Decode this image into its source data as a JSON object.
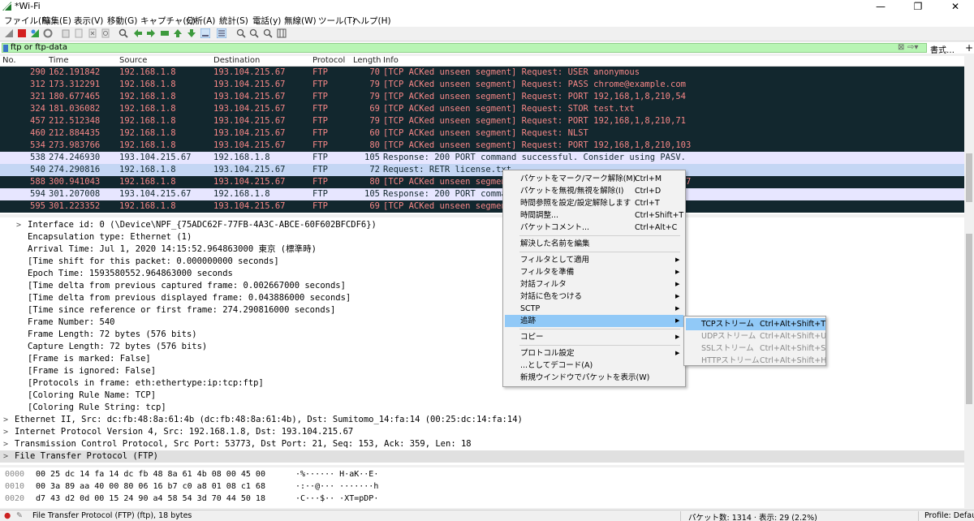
{
  "window": {
    "title": "*Wi-Fi",
    "minimize": "—",
    "restore": "❐",
    "close": "✕"
  },
  "menu": [
    "ファイル(F)",
    "編集(E)",
    "表示(V)",
    "移動(G)",
    "キャプチャ(C)",
    "分析(A)",
    "統計(S)",
    "電話(y)",
    "無線(W)",
    "ツール(T)",
    "ヘルプ(H)"
  ],
  "filter": {
    "value": "ftp or ftp-data",
    "expression_label": "書式…",
    "add_label": "+"
  },
  "columns": [
    "No.",
    "Time",
    "Source",
    "Destination",
    "Protocol",
    "Length",
    "Info"
  ],
  "packets": [
    {
      "no": "290",
      "time": "162.191842",
      "src": "192.168.1.8",
      "dst": "193.104.215.67",
      "proto": "FTP",
      "len": "70",
      "info": "[TCP ACKed unseen segment] Request: USER anonymous",
      "style": "dark"
    },
    {
      "no": "312",
      "time": "173.312291",
      "src": "192.168.1.8",
      "dst": "193.104.215.67",
      "proto": "FTP",
      "len": "79",
      "info": "[TCP ACKed unseen segment] Request: PASS chrome@example.com",
      "style": "dark"
    },
    {
      "no": "321",
      "time": "180.677465",
      "src": "192.168.1.8",
      "dst": "193.104.215.67",
      "proto": "FTP",
      "len": "79",
      "info": "[TCP ACKed unseen segment] Request: PORT 192,168,1,8,210,54",
      "style": "dark"
    },
    {
      "no": "324",
      "time": "181.036082",
      "src": "192.168.1.8",
      "dst": "193.104.215.67",
      "proto": "FTP",
      "len": "69",
      "info": "[TCP ACKed unseen segment] Request: STOR test.txt",
      "style": "dark"
    },
    {
      "no": "457",
      "time": "212.512348",
      "src": "192.168.1.8",
      "dst": "193.104.215.67",
      "proto": "FTP",
      "len": "79",
      "info": "[TCP ACKed unseen segment] Request: PORT 192,168,1,8,210,71",
      "style": "dark"
    },
    {
      "no": "460",
      "time": "212.884435",
      "src": "192.168.1.8",
      "dst": "193.104.215.67",
      "proto": "FTP",
      "len": "60",
      "info": "[TCP ACKed unseen segment] Request: NLST",
      "style": "dark"
    },
    {
      "no": "534",
      "time": "273.983766",
      "src": "192.168.1.8",
      "dst": "193.104.215.67",
      "proto": "FTP",
      "len": "80",
      "info": "[TCP ACKed unseen segment] Request: PORT 192,168,1,8,210,103",
      "style": "dark"
    },
    {
      "no": "538",
      "time": "274.246930",
      "src": "193.104.215.67",
      "dst": "192.168.1.8",
      "proto": "FTP",
      "len": "105",
      "info": "Response: 200 PORT command successful. Consider using PASV.",
      "style": "light"
    },
    {
      "no": "540",
      "time": "274.290816",
      "src": "192.168.1.8",
      "dst": "193.104.215.67",
      "proto": "FTP",
      "len": "72",
      "info": "Request: RETR license.txt",
      "style": "sel"
    },
    {
      "no": "588",
      "time": "300.941043",
      "src": "192.168.1.8",
      "dst": "193.104.215.67",
      "proto": "FTP",
      "len": "80",
      "info": "[TCP ACKed unseen segment] Request: PORT 192,168,1,8,210,107",
      "style": "dark"
    },
    {
      "no": "594",
      "time": "301.207008",
      "src": "193.104.215.67",
      "dst": "192.168.1.8",
      "proto": "FTP",
      "len": "105",
      "info": "Response: 200 PORT command successful. Consider using PASV.",
      "style": "light"
    },
    {
      "no": "595",
      "time": "301.223352",
      "src": "192.168.1.8",
      "dst": "193.104.215.67",
      "proto": "FTP",
      "len": "69",
      "info": "[TCP ACKed unseen segment] Request: RETR test.txt",
      "style": "dark"
    }
  ],
  "details": [
    {
      "indent": 1,
      "arrow": ">",
      "text": "Interface id: 0 (\\Device\\NPF_{75ADC62F-77FB-4A3C-ABCE-60F602BFCDF6})"
    },
    {
      "indent": 1,
      "arrow": "",
      "text": "Encapsulation type: Ethernet (1)"
    },
    {
      "indent": 1,
      "arrow": "",
      "text": "Arrival Time: Jul  1, 2020 14:15:52.964863000 東京 (標準時)"
    },
    {
      "indent": 1,
      "arrow": "",
      "text": "[Time shift for this packet: 0.000000000 seconds]"
    },
    {
      "indent": 1,
      "arrow": "",
      "text": "Epoch Time: 1593580552.964863000 seconds"
    },
    {
      "indent": 1,
      "arrow": "",
      "text": "[Time delta from previous captured frame: 0.002667000 seconds]"
    },
    {
      "indent": 1,
      "arrow": "",
      "text": "[Time delta from previous displayed frame: 0.043886000 seconds]"
    },
    {
      "indent": 1,
      "arrow": "",
      "text": "[Time since reference or first frame: 274.290816000 seconds]"
    },
    {
      "indent": 1,
      "arrow": "",
      "text": "Frame Number: 540"
    },
    {
      "indent": 1,
      "arrow": "",
      "text": "Frame Length: 72 bytes (576 bits)"
    },
    {
      "indent": 1,
      "arrow": "",
      "text": "Capture Length: 72 bytes (576 bits)"
    },
    {
      "indent": 1,
      "arrow": "",
      "text": "[Frame is marked: False]"
    },
    {
      "indent": 1,
      "arrow": "",
      "text": "[Frame is ignored: False]"
    },
    {
      "indent": 1,
      "arrow": "",
      "text": "[Protocols in frame: eth:ethertype:ip:tcp:ftp]"
    },
    {
      "indent": 1,
      "arrow": "",
      "text": "[Coloring Rule Name: TCP]"
    },
    {
      "indent": 1,
      "arrow": "",
      "text": "[Coloring Rule String: tcp]"
    },
    {
      "indent": 0,
      "arrow": ">",
      "text": "Ethernet II, Src: dc:fb:48:8a:61:4b (dc:fb:48:8a:61:4b), Dst: Sumitomo_14:fa:14 (00:25:dc:14:fa:14)"
    },
    {
      "indent": 0,
      "arrow": ">",
      "text": "Internet Protocol Version 4, Src: 192.168.1.8, Dst: 193.104.215.67"
    },
    {
      "indent": 0,
      "arrow": ">",
      "text": "Transmission Control Protocol, Src Port: 53773, Dst Port: 21, Seq: 153, Ack: 359, Len: 18"
    },
    {
      "indent": 0,
      "arrow": ">",
      "text": "File Transfer Protocol (FTP)",
      "highlight": true
    }
  ],
  "bytes": [
    {
      "off": "0000",
      "hex": "00 25 dc 14 fa 14 dc fb  48 8a 61 4b 08 00 45 00",
      "ascii": "·%······ H·aK··E·"
    },
    {
      "off": "0010",
      "hex": "00 3a 89 aa 40 00 80 06  16 b7 c0 a8 01 08 c1 68",
      "ascii": "·:··@··· ·······h"
    },
    {
      "off": "0020",
      "hex": "d7 43 d2 0d 00 15 24 90  a4 58 54 3d 70 44 50 18",
      "ascii": "·C···$·· ·XT=pDP·"
    }
  ],
  "status": {
    "left": "File Transfer Protocol (FTP) (ftp), 18 bytes",
    "packets": "パケット数: 1314 · 表示: 29 (2.2%)",
    "profile": "Profile: Default"
  },
  "context_menu": [
    {
      "label": "パケットをマーク/マーク解除(M)",
      "shortcut": "Ctrl+M"
    },
    {
      "label": "パケットを無視/無視を解除(I)",
      "shortcut": "Ctrl+D"
    },
    {
      "label": "時間参照を設定/設定解除します",
      "shortcut": "Ctrl+T"
    },
    {
      "label": "時間調整...",
      "shortcut": "Ctrl+Shift+T"
    },
    {
      "label": "パケットコメント...",
      "shortcut": "Ctrl+Alt+C"
    },
    {
      "label": "解決した名前を編集",
      "shortcut": ""
    },
    {
      "label": "フィルタとして適用",
      "shortcut": "",
      "sub": true
    },
    {
      "label": "フィルタを準備",
      "shortcut": "",
      "sub": true
    },
    {
      "label": "対話フィルタ",
      "shortcut": "",
      "sub": true
    },
    {
      "label": "対話に色をつける",
      "shortcut": "",
      "sub": true
    },
    {
      "label": "SCTP",
      "shortcut": "",
      "sub": true
    },
    {
      "label": "追跡",
      "shortcut": "",
      "sub": true,
      "active": true
    },
    {
      "label": "コピー",
      "shortcut": "",
      "sub": true
    },
    {
      "label": "プロトコル設定",
      "shortcut": "",
      "sub": true
    },
    {
      "label": "...としてデコード(A)",
      "shortcut": ""
    },
    {
      "label": "新規ウインドウでパケットを表示(W)",
      "shortcut": ""
    }
  ],
  "submenu": [
    {
      "label": "TCPストリーム",
      "shortcut": "Ctrl+Alt+Shift+T",
      "active": true
    },
    {
      "label": "UDPストリーム",
      "shortcut": "Ctrl+Alt+Shift+U",
      "disabled": true
    },
    {
      "label": "SSLストリーム",
      "shortcut": "Ctrl+Alt+Shift+S",
      "disabled": true
    },
    {
      "label": "HTTPストリーム",
      "shortcut": "Ctrl+Alt+Shift+H",
      "disabled": true
    }
  ],
  "colors": {
    "dark_row_bg": "#12272e",
    "dark_row_fg": "#f78787",
    "light_row_bg": "#e7e6ff",
    "selected_bg": "#c4d6f4",
    "filter_ok": "#b8f5b4",
    "menu_highlight": "#91c9f7"
  }
}
